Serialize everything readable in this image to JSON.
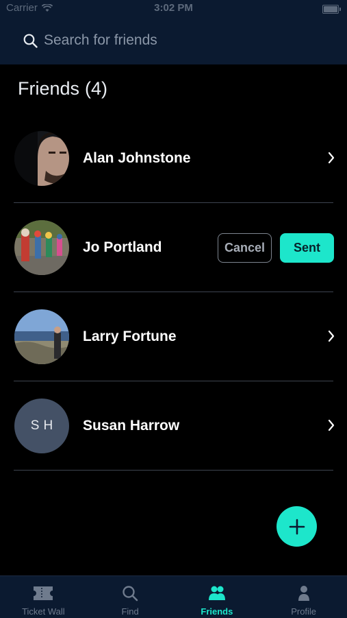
{
  "status_bar": {
    "carrier": "Carrier",
    "time": "3:02 PM"
  },
  "search": {
    "placeholder": "Search for friends"
  },
  "friends_section": {
    "title": "Friends",
    "count": "(4)"
  },
  "friends": [
    {
      "name": "Alan Johnstone",
      "avatar": "photo",
      "action": "chevron"
    },
    {
      "name": "Jo Portland",
      "avatar": "photo",
      "action": "buttons"
    },
    {
      "name": "Larry Fortune",
      "avatar": "photo",
      "action": "chevron"
    },
    {
      "name": "Susan Harrow",
      "avatar": "initials",
      "initials": "SH",
      "action": "chevron"
    }
  ],
  "pending_request": {
    "cancel_label": "Cancel",
    "sent_label": "Sent"
  },
  "tabs": [
    {
      "label": "Ticket Wall",
      "icon": "ticket-icon",
      "active": false
    },
    {
      "label": "Find",
      "icon": "search-icon",
      "active": false
    },
    {
      "label": "Friends",
      "icon": "friends-icon",
      "active": true
    },
    {
      "label": "Profile",
      "icon": "profile-icon",
      "active": false
    }
  ],
  "colors": {
    "accent": "#1de6cb",
    "header_bg": "#0b1a30",
    "background": "#000000",
    "divider": "#3e4450",
    "initials_avatar_bg": "#445166"
  }
}
